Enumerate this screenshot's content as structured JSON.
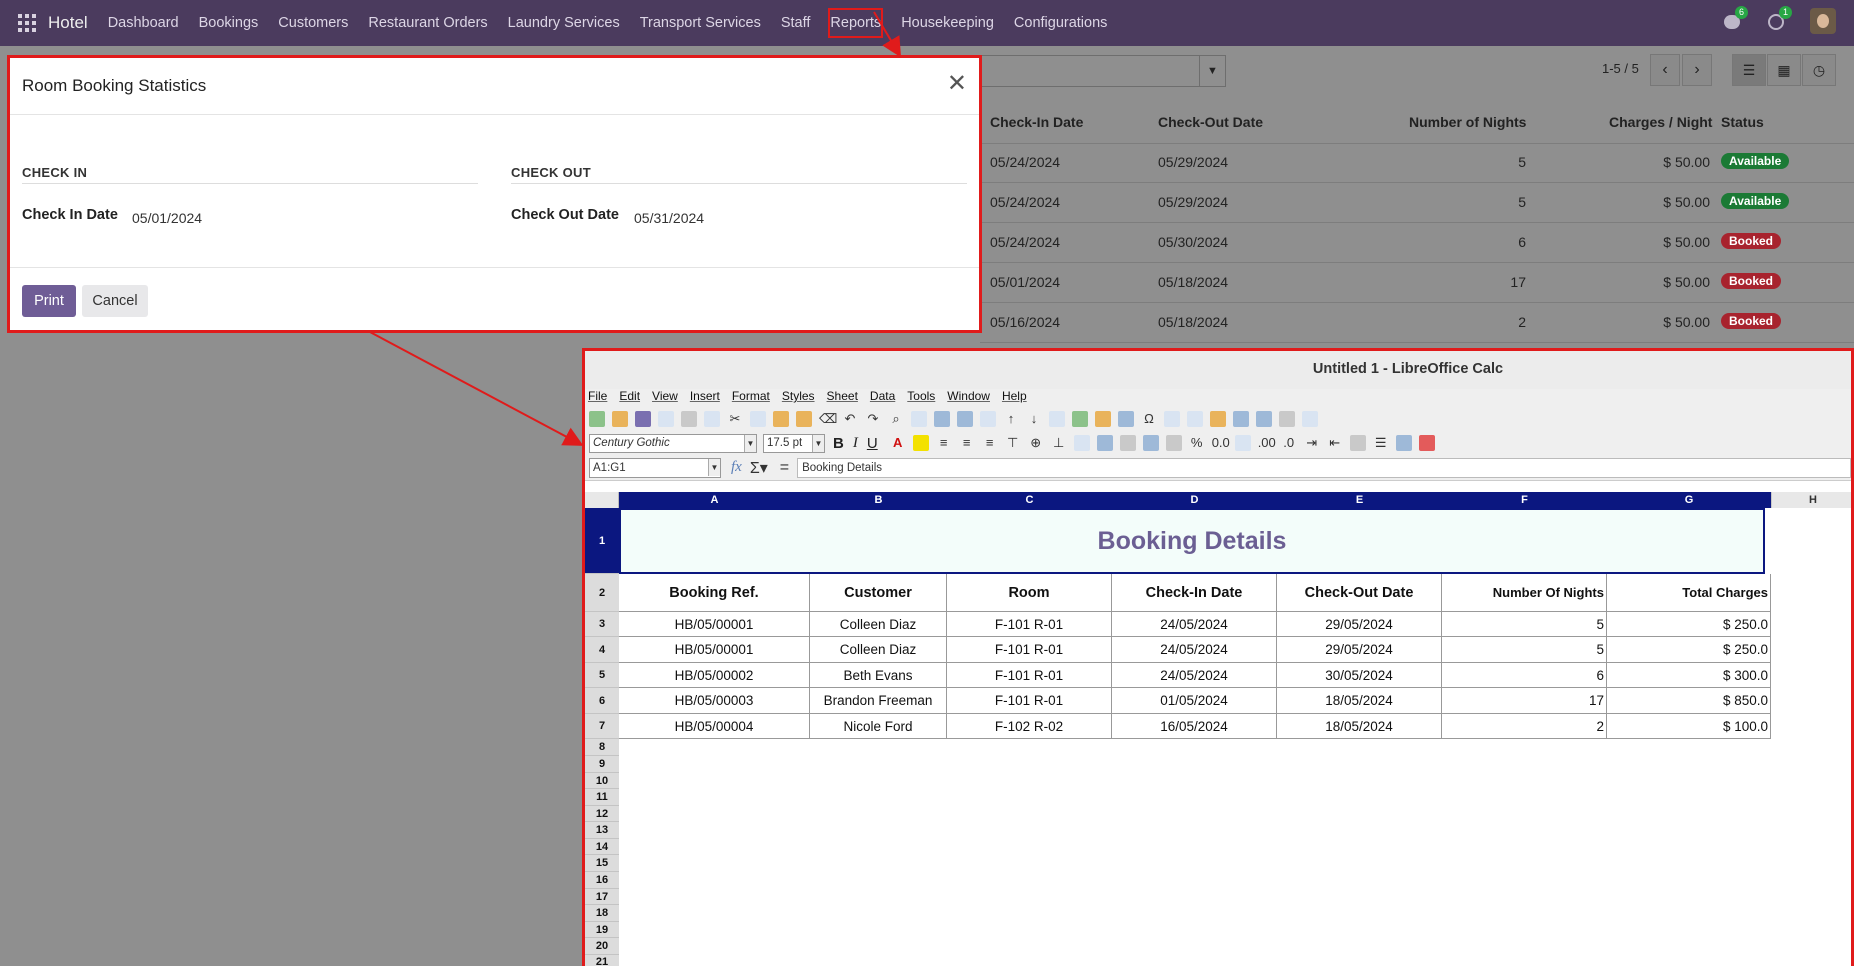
{
  "navbar": {
    "brand": "Hotel",
    "menu": [
      "Dashboard",
      "Bookings",
      "Customers",
      "Restaurant Orders",
      "Laundry Services",
      "Transport Services",
      "Staff",
      "Reports",
      "Housekeeping",
      "Configurations"
    ],
    "chat_badge": "6",
    "activity_badge": "1"
  },
  "list": {
    "pager": "1-5 / 5",
    "columns": [
      "Check-In Date",
      "Check-Out Date",
      "Number of Nights",
      "Charges / Night",
      "Status"
    ],
    "rows": [
      {
        "checkin": "05/24/2024",
        "checkout": "05/29/2024",
        "nights": "5",
        "charge": "$ 50.00",
        "status": "Available"
      },
      {
        "checkin": "05/24/2024",
        "checkout": "05/29/2024",
        "nights": "5",
        "charge": "$ 50.00",
        "status": "Available"
      },
      {
        "checkin": "05/24/2024",
        "checkout": "05/30/2024",
        "nights": "6",
        "charge": "$ 50.00",
        "status": "Booked"
      },
      {
        "checkin": "05/01/2024",
        "checkout": "05/18/2024",
        "nights": "17",
        "charge": "$ 50.00",
        "status": "Booked"
      },
      {
        "checkin": "05/16/2024",
        "checkout": "05/18/2024",
        "nights": "2",
        "charge": "$ 50.00",
        "status": "Booked"
      }
    ]
  },
  "modal": {
    "title": "Room Booking Statistics",
    "check_in_section": "CHECK IN",
    "check_out_section": "CHECK OUT",
    "check_in_label": "Check In Date",
    "check_in_value": "05/01/2024",
    "check_out_label": "Check Out Date",
    "check_out_value": "05/31/2024",
    "print_label": "Print",
    "cancel_label": "Cancel"
  },
  "calc": {
    "title": "Untitled 1 - LibreOffice Calc",
    "menu": [
      "File",
      "Edit",
      "View",
      "Insert",
      "Format",
      "Styles",
      "Sheet",
      "Data",
      "Tools",
      "Window",
      "Help"
    ],
    "font_name": "Century Gothic",
    "font_size": "17.5 pt",
    "name_box": "A1:G1",
    "formula": "Booking Details",
    "columns": [
      "A",
      "B",
      "C",
      "D",
      "E",
      "F",
      "G",
      "H"
    ],
    "sheet_title": "Booking Details",
    "headers": [
      "Booking Ref.",
      "Customer",
      "Room",
      "Check-In Date",
      "Check-Out Date",
      "Number Of Nights",
      "Total Charges"
    ],
    "rows": [
      [
        "HB/05/00001",
        "Colleen Diaz",
        "F-101 R-01",
        "24/05/2024",
        "29/05/2024",
        "5",
        "$ 250.0"
      ],
      [
        "HB/05/00001",
        "Colleen Diaz",
        "F-101 R-01",
        "24/05/2024",
        "29/05/2024",
        "5",
        "$ 250.0"
      ],
      [
        "HB/05/00002",
        "Beth Evans",
        "F-101 R-01",
        "24/05/2024",
        "30/05/2024",
        "6",
        "$ 300.0"
      ],
      [
        "HB/05/00003",
        "Brandon Freeman",
        "F-101 R-01",
        "01/05/2024",
        "18/05/2024",
        "17",
        "$ 850.0"
      ],
      [
        "HB/05/00004",
        "Nicole Ford",
        "F-102 R-02",
        "16/05/2024",
        "18/05/2024",
        "2",
        "$ 100.0"
      ]
    ],
    "row_numbers": [
      "1",
      "2",
      "3",
      "4",
      "5",
      "6",
      "7",
      "8",
      "9",
      "10",
      "11",
      "12",
      "13",
      "14",
      "15",
      "16",
      "17",
      "18",
      "19",
      "20",
      "21"
    ]
  },
  "colors": {
    "accent": "#6f5d96",
    "navbar": "#4b3b5e",
    "highlight": "#e01b1b",
    "selection": "#0b1780"
  }
}
